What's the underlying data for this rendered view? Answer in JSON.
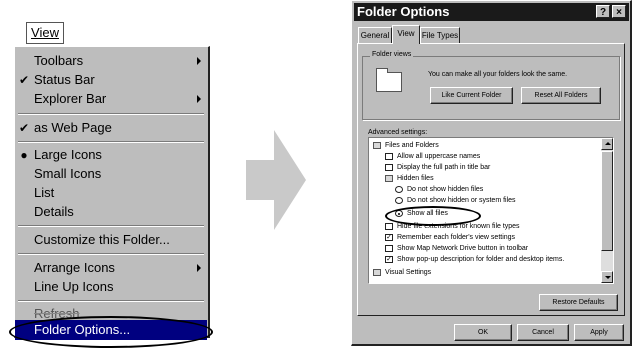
{
  "menu": {
    "title": "View",
    "items": [
      {
        "label": "Toolbars",
        "submenu": true
      },
      {
        "label": "Status Bar",
        "check": "✔"
      },
      {
        "label": "Explorer Bar",
        "submenu": true
      },
      {
        "label": "as Web Page",
        "check": "✔"
      },
      {
        "label": "Large Icons",
        "check": "●"
      },
      {
        "label": "Small Icons"
      },
      {
        "label": "List"
      },
      {
        "label": "Details"
      },
      {
        "label": "Customize this Folder..."
      },
      {
        "label": "Arrange Icons",
        "submenu": true
      },
      {
        "label": "Line Up Icons"
      },
      {
        "label": "Refresh"
      },
      {
        "label": "Folder Options..."
      }
    ]
  },
  "dialog": {
    "title": "Folder Options",
    "help_btn": "?",
    "close_btn": "×",
    "tabs": [
      "General",
      "View",
      "File Types"
    ],
    "active_tab": "View",
    "folder_views": {
      "legend": "Folder views",
      "description": "You can make all your folders look the same.",
      "like_current_btn": "Like Current Folder",
      "reset_all_btn": "Reset All Folders"
    },
    "advanced_label": "Advanced settings:",
    "tree": [
      {
        "text": "Files and Folders",
        "kind": "folder",
        "indent": 0
      },
      {
        "text": "Allow all uppercase names",
        "kind": "checkbox",
        "indent": 1,
        "checked": false
      },
      {
        "text": "Display the full path in title bar",
        "kind": "checkbox",
        "indent": 1,
        "checked": false
      },
      {
        "text": "Hidden files",
        "kind": "folder",
        "indent": 1
      },
      {
        "text": "Do not show hidden files",
        "kind": "radio",
        "indent": 2,
        "checked": false
      },
      {
        "text": "Do not show hidden or system files",
        "kind": "radio",
        "indent": 2,
        "checked": false
      },
      {
        "text": "Show all files",
        "kind": "radio",
        "indent": 2,
        "checked": true
      },
      {
        "text": "Hide file extensions for known file types",
        "kind": "checkbox",
        "indent": 1,
        "checked": false
      },
      {
        "text": "Remember each folder's view settings",
        "kind": "checkbox",
        "indent": 1,
        "checked": true
      },
      {
        "text": "Show Map Network Drive button in toolbar",
        "kind": "checkbox",
        "indent": 1,
        "checked": false
      },
      {
        "text": "Show pop-up description for folder and desktop items.",
        "kind": "checkbox",
        "indent": 1,
        "checked": true
      },
      {
        "text": "Visual Settings",
        "kind": "folder",
        "indent": 0
      }
    ],
    "restore_btn": "Restore Defaults",
    "ok_btn": "OK",
    "cancel_btn": "Cancel",
    "apply_btn": "Apply"
  }
}
